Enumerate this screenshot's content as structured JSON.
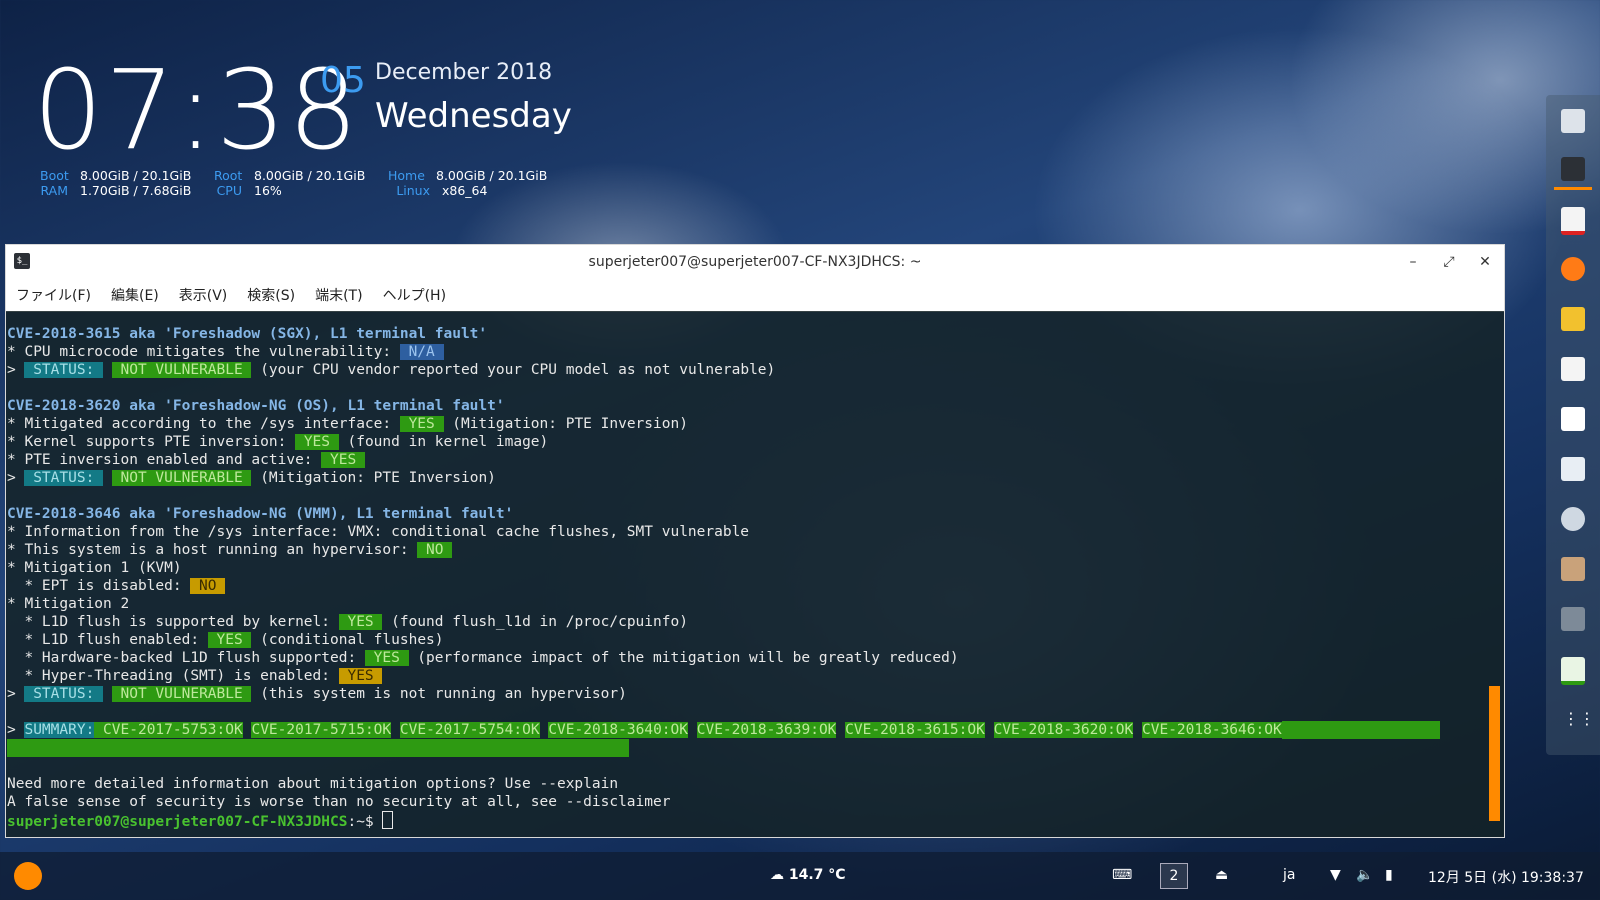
{
  "clock": {
    "time": "07:38",
    "day": "05",
    "month_year": "December 2018",
    "weekday": "Wednesday"
  },
  "stats": [
    {
      "label": "Boot",
      "value": "8.00GiB / 20.1GiB"
    },
    {
      "label": "RAM",
      "value": "1.70GiB / 7.68GiB"
    },
    {
      "label": "Root",
      "value": "8.00GiB / 20.1GiB"
    },
    {
      "label": "CPU",
      "value": "16%"
    },
    {
      "label": "Home",
      "value": "8.00GiB / 20.1GiB"
    },
    {
      "label": "Linux",
      "value": "x86_64"
    }
  ],
  "window": {
    "title": "superjeter007@superjeter007-CF-NX3JDHCS: ~",
    "icon_text": "$_",
    "minimize": "–",
    "maximize": "⤢",
    "close": "✕"
  },
  "menu": [
    "ファイル(F)",
    "編集(E)",
    "表示(V)",
    "検索(S)",
    "端末(T)",
    "ヘルプ(H)"
  ],
  "terminal": {
    "sec1": {
      "header": "CVE-2018-3615 aka 'Foreshadow (SGX), L1 terminal fault'",
      "l1": "* CPU microcode mitigates the vulnerability: ",
      "l1_badge": " N/A ",
      "status_prefix": "> ",
      "status": " STATUS: ",
      "not_vuln": " NOT VULNERABLE ",
      "status_text": " (your CPU vendor reported your CPU model as not vulnerable)"
    },
    "sec2": {
      "header": "CVE-2018-3620 aka 'Foreshadow-NG (OS), L1 terminal fault'",
      "l1": "* Mitigated according to the /sys interface: ",
      "l1_badge": " YES ",
      "l1_tail": " (Mitigation: PTE Inversion)",
      "l2": "* Kernel supports PTE inversion: ",
      "l2_badge": " YES ",
      "l2_tail": " (found in kernel image)",
      "l3": "* PTE inversion enabled and active: ",
      "l3_badge": " YES ",
      "status_text": " (Mitigation: PTE Inversion)"
    },
    "sec3": {
      "header": "CVE-2018-3646 aka 'Foreshadow-NG (VMM), L1 terminal fault'",
      "l1": "* Information from the /sys interface: VMX: conditional cache flushes, SMT vulnerable",
      "l2": "* This system is a host running an hypervisor: ",
      "l2_badge": " NO ",
      "l3": "* Mitigation 1 (KVM)",
      "l4": "  * EPT is disabled: ",
      "l4_badge": " NO ",
      "l5": "* Mitigation 2",
      "l6": "  * L1D flush is supported by kernel: ",
      "l6_badge": " YES ",
      "l6_tail": " (found flush_l1d in /proc/cpuinfo)",
      "l7": "  * L1D flush enabled: ",
      "l7_badge": " YES ",
      "l7_tail": " (conditional flushes)",
      "l8": "  * Hardware-backed L1D flush supported: ",
      "l8_badge": " YES ",
      "l8_tail": " (performance impact of the mitigation will be greatly reduced)",
      "l9": "  * Hyper-Threading (SMT) is enabled: ",
      "l9_badge": " YES ",
      "status_text": " (this system is not running an hypervisor)"
    },
    "summary": {
      "label": "SUMMARY:",
      "items": [
        "CVE-2017-5753:OK",
        "CVE-2017-5715:OK",
        "CVE-2017-5754:OK",
        "CVE-2018-3640:OK",
        "CVE-2018-3639:OK",
        "CVE-2018-3615:OK",
        "CVE-2018-3620:OK",
        "CVE-2018-3646:OK"
      ]
    },
    "footer1": "Need more detailed information about mitigation options? Use --explain",
    "footer2": "A false sense of security is worse than no security at all, see --disclaimer",
    "prompt": "superjeter007@superjeter007-CF-NX3JDHCS",
    "prompt_tail": ":~$ "
  },
  "dock_icons": [
    "files-icon",
    "terminal-icon",
    "pdf-viewer-icon",
    "firefox-icon",
    "mail-icon",
    "calendar-icon",
    "document-icon",
    "system-monitor-icon",
    "settings-icon",
    "folder-icon",
    "drive-icon",
    "spreadsheet-icon",
    "app-grid-icon"
  ],
  "taskbar": {
    "weather": "14.7 °C",
    "workspace": "2",
    "ime": "ja",
    "clock": "12月 5日 (水) 19:38:37"
  },
  "colors": {
    "accent_blue": "#3c9bf0",
    "status_green": "#2e9a12",
    "warning_yellow": "#c79b00",
    "scrollbar_orange": "#ff8a00",
    "cve_blue": "#85b6e6"
  }
}
